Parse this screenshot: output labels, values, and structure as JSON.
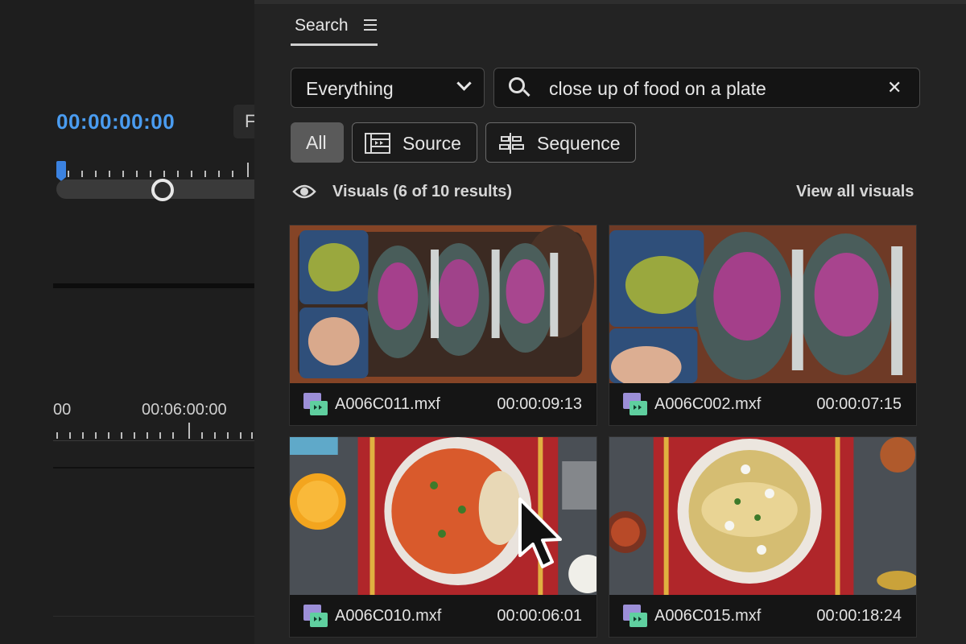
{
  "timeline": {
    "current_timecode": "00:00:00:00",
    "panel_button_label": "F",
    "ruler_label_left": "00",
    "ruler_label": "00:06:00:00"
  },
  "search_panel": {
    "tab_label": "Search",
    "scope": {
      "selected": "Everything"
    },
    "query": {
      "value": "close up of food on a plate"
    },
    "filters": [
      {
        "label": "All",
        "active": true
      },
      {
        "label": "Source",
        "active": false
      },
      {
        "label": "Sequence",
        "active": false
      }
    ],
    "results_header": "Visuals (6 of 10 results)",
    "view_all_label": "View all visuals",
    "results": [
      {
        "name": "A006C011.mxf",
        "duration": "00:00:09:13"
      },
      {
        "name": "A006C002.mxf",
        "duration": "00:00:07:15"
      },
      {
        "name": "A006C010.mxf",
        "duration": "00:00:06:01"
      },
      {
        "name": "A006C015.mxf",
        "duration": "00:00:18:24"
      }
    ]
  },
  "colors": {
    "accent_timecode": "#4a9cf0",
    "clip_icon": "#7fc8a9",
    "panel_bg": "#232323"
  },
  "icons": [
    "menu-icon",
    "chevron-down-icon",
    "search-icon",
    "clear-icon",
    "source-clip-icon",
    "sequence-icon",
    "eye-icon",
    "clip-icon",
    "mouse-cursor-icon"
  ]
}
